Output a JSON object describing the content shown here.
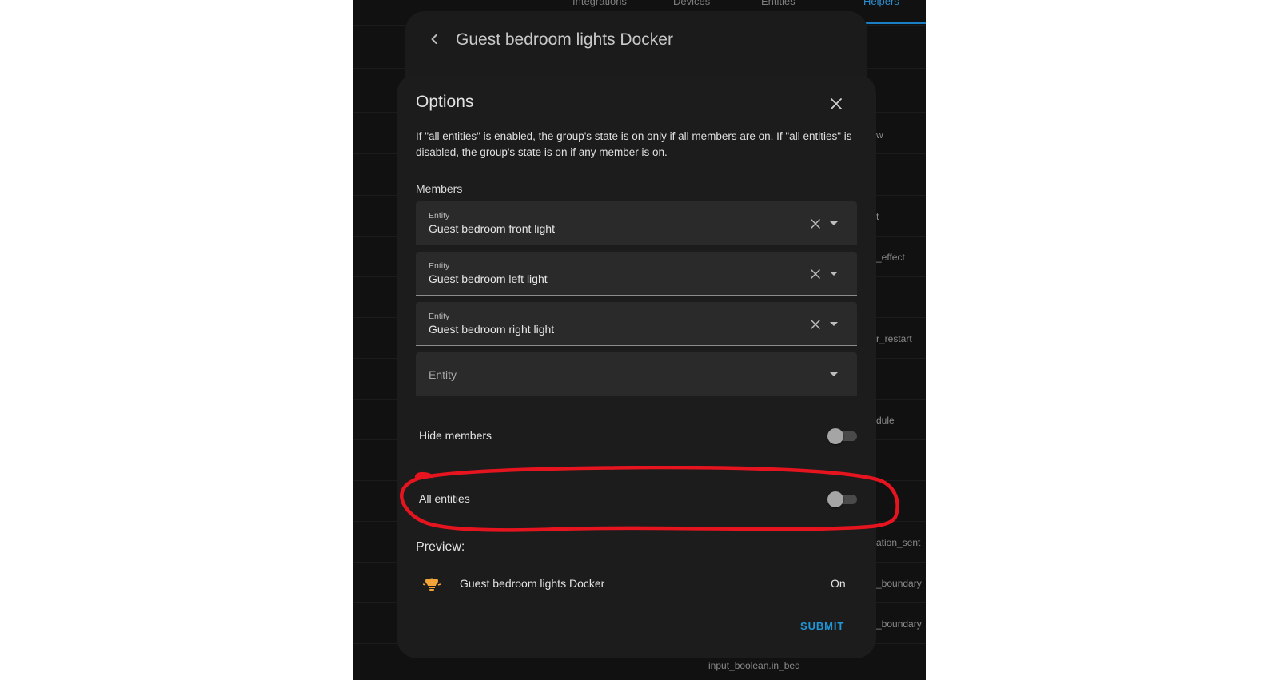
{
  "background": {
    "tabs": [
      {
        "label": "Integrations"
      },
      {
        "label": "Devices"
      },
      {
        "label": "Entities"
      },
      {
        "label": "Helpers",
        "active": true
      }
    ],
    "entity_fragments": [
      "w",
      "t",
      "_effect",
      "r_restart",
      "dule",
      "ation_sent",
      "_boundary",
      "_boundary",
      "input_boolean.in_bed"
    ]
  },
  "page": {
    "title": "Guest bedroom lights Docker",
    "back_icon": "chevron-left-icon"
  },
  "dialog": {
    "title": "Options",
    "description": "If \"all entities\" is enabled, the group's state is on only if all members are on. If \"all entities\" is disabled, the group's state is on if any member is on.",
    "members_label": "Members",
    "members": [
      {
        "label": "Entity",
        "value": "Guest bedroom front light"
      },
      {
        "label": "Entity",
        "value": "Guest bedroom left light"
      },
      {
        "label": "Entity",
        "value": "Guest bedroom right light"
      }
    ],
    "empty_entity_placeholder": "Entity",
    "hide_members": {
      "label": "Hide members",
      "enabled": false
    },
    "all_entities": {
      "label": "All entities",
      "enabled": false
    },
    "preview": {
      "label": "Preview:",
      "entity_name": "Guest bedroom lights Docker",
      "state": "On",
      "icon": "lightbulb-group-icon",
      "icon_color": "#f4a438"
    },
    "submit_label": "SUBMIT"
  },
  "colors": {
    "accent": "#2196d8",
    "annotation": "#e5141f"
  }
}
